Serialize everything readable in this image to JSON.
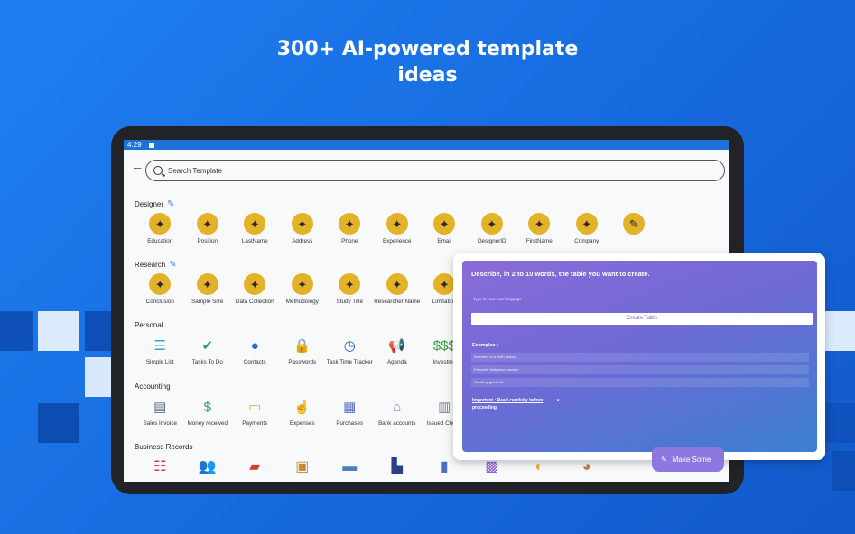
{
  "headline": {
    "line1": "300+ AI-powered template",
    "line2": "ideas"
  },
  "colors": {
    "background": "#1f7ff0",
    "accent_gold": "#e4b228",
    "panel": "#7a6bd6"
  },
  "status_bar": {
    "time": "4:29"
  },
  "search": {
    "placeholder": "Search Template"
  },
  "sections": {
    "designer": "Designer",
    "research": "Research",
    "personal": "Personal",
    "accounting": "Accounting",
    "business_records": "Business Records"
  },
  "designer_items": [
    "Education",
    "Position",
    "LastName",
    "Address",
    "Phone",
    "Experience",
    "Email",
    "DesignerID",
    "FirstName",
    "Company",
    ""
  ],
  "research_items": [
    "Conclusion",
    "Sample Size",
    "Data Collection",
    "Methodology",
    "Study Title",
    "Researcher Name",
    "Limitation"
  ],
  "personal_items": [
    {
      "label": "Simple List",
      "icon": "list-icon",
      "glyph": "☰",
      "color": "#27a7d9"
    },
    {
      "label": "Tasks To Do",
      "icon": "checklist-icon",
      "glyph": "✔",
      "color": "#2e9e5a"
    },
    {
      "label": "Contacts",
      "icon": "contacts-icon",
      "glyph": "●",
      "color": "#1f6fd1"
    },
    {
      "label": "Passwords",
      "icon": "lock-icon",
      "glyph": "🔒",
      "color": "#3a9a3a"
    },
    {
      "label": "Task Time Tracker",
      "icon": "clock-icon",
      "glyph": "◷",
      "color": "#2a5fc7"
    },
    {
      "label": "Agenda",
      "icon": "megaphone-icon",
      "glyph": "📢",
      "color": "#148a6a"
    },
    {
      "label": "Investme",
      "icon": "money-icon",
      "glyph": "$$$",
      "color": "#2f9e3f"
    }
  ],
  "accounting_items": [
    {
      "label": "Sales Invoice",
      "icon": "invoice-icon",
      "glyph": "▤",
      "color": "#5e6b86"
    },
    {
      "label": "Money received",
      "icon": "money-hand-icon",
      "glyph": "$",
      "color": "#2e9e5a"
    },
    {
      "label": "Payments",
      "icon": "card-icon",
      "glyph": "▭",
      "color": "#e0a12a"
    },
    {
      "label": "Expenses",
      "icon": "expense-icon",
      "glyph": "☝",
      "color": "#d07a28"
    },
    {
      "label": "Purchases",
      "icon": "purchase-icon",
      "glyph": "▦",
      "color": "#5b6cc7"
    },
    {
      "label": "Bank accounts",
      "icon": "bank-icon",
      "glyph": "⌂",
      "color": "#8a8f9e"
    },
    {
      "label": "Issued Chequ",
      "icon": "cheque-icon",
      "glyph": "▥",
      "color": "#7a8090"
    }
  ],
  "business_icons": [
    {
      "icon": "id-card-icon",
      "glyph": "☷",
      "color": "#d93a3a"
    },
    {
      "icon": "people-icon",
      "glyph": "👥",
      "color": "#d98a2a"
    },
    {
      "icon": "book-icon",
      "glyph": "▰",
      "color": "#d93a2a"
    },
    {
      "icon": "presentation-icon",
      "glyph": "▣",
      "color": "#c98a2a"
    },
    {
      "icon": "desk-icon",
      "glyph": "▬",
      "color": "#4a7fc0"
    },
    {
      "icon": "factory-icon",
      "glyph": "▙",
      "color": "#2a3f8a"
    },
    {
      "icon": "bar-chart-icon",
      "glyph": "▮",
      "color": "#4a6fd0"
    },
    {
      "icon": "gift-icon",
      "glyph": "▩",
      "color": "#8a5ad0"
    },
    {
      "icon": "bulb-icon",
      "glyph": "◐",
      "color": "#e0b23a"
    },
    {
      "icon": "worker-icon",
      "glyph": "◕",
      "color": "#d07a3a"
    }
  ],
  "overlay": {
    "title": "Describe, in 2 to 10 words, the table you want to create.",
    "input_hint": "Type in your own language",
    "create_button": "Create Table",
    "examples_label": "Examples :",
    "examples": [
      "Inventory in a cloth factory",
      "Favourite bollywood movies",
      "Wedding guest list"
    ],
    "important": "Important : Read carefully before proceeding"
  },
  "fab": {
    "label": "Make Some"
  }
}
